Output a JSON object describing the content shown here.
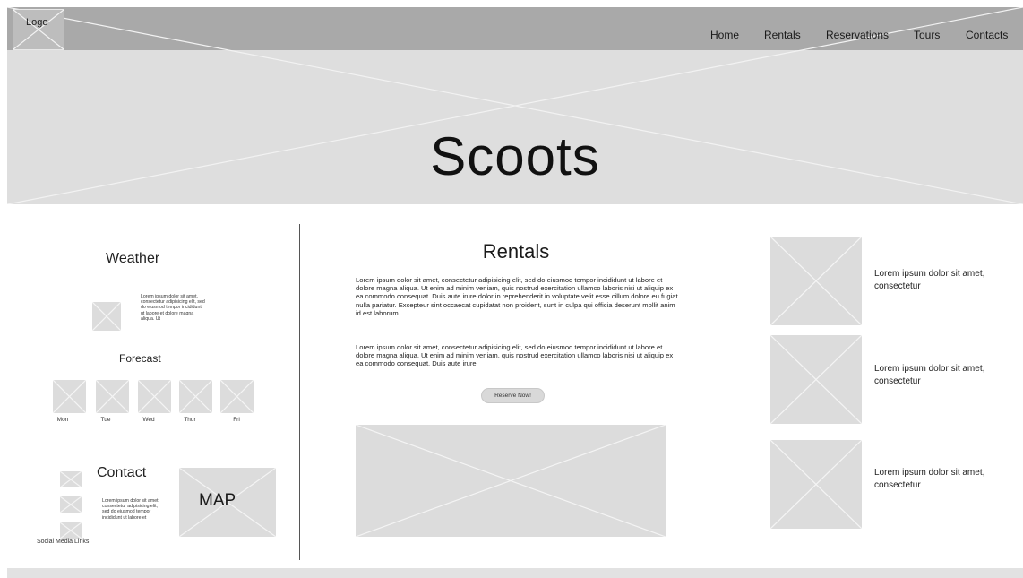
{
  "header": {
    "logo_label": "Logo",
    "nav": [
      "Home",
      "Rentals",
      "Reservations",
      "Tours",
      "Contacts"
    ],
    "site_title": "Scoots"
  },
  "left": {
    "weather_title": "Weather",
    "weather_text": "Lorem ipsum dolor sit amet, consectetur adipisicing elit, sed do eiusmod tempor incididunt ut labore et dolore magna aliqua. Ut",
    "forecast_title": "Forecast",
    "forecast_days": [
      "Mon",
      "Tue",
      "Wed",
      "Thur",
      "Fri"
    ],
    "contact_title": "Contact",
    "contact_text": "Lorem ipsum dolor sit amet, consectetur adipisicing elit, sed do eiusmod tempor incididunt ut labore et",
    "social_label": "Social Media Links",
    "map_label": "MAP"
  },
  "center": {
    "title": "Rentals",
    "paragraph_1": "Lorem ipsum dolor sit amet, consectetur adipisicing elit, sed do eiusmod tempor incididunt ut labore et dolore magna aliqua. Ut enim ad minim veniam, quis nostrud exercitation ullamco laboris nisi ut aliquip ex ea commodo consequat. Duis aute irure dolor in reprehenderit in voluptate velit esse cillum dolore eu fugiat nulla pariatur. Excepteur sint occaecat cupidatat non proident, sunt in culpa qui officia deserunt mollit anim id est laborum.",
    "paragraph_2": "Lorem ipsum dolor sit amet, consectetur adipisicing elit, sed do eiusmod tempor incididunt ut labore et dolore magna aliqua. Ut enim ad minim veniam, quis nostrud exercitation ullamco laboris nisi ut aliquip ex ea commodo consequat. Duis aute irure",
    "button_label": "Reserve Now!"
  },
  "right": {
    "items": [
      {
        "text": "Lorem ipsum dolor sit amet, consectetur"
      },
      {
        "text": "Lorem ipsum dolor sit amet, consectetur"
      },
      {
        "text": "Lorem ipsum dolor sit amet, consectetur"
      }
    ]
  },
  "colors": {
    "nav_bar": "#a9a9a9",
    "hero": "#dedede",
    "placeholder": "#dcdcdc",
    "divider": "#555555"
  }
}
